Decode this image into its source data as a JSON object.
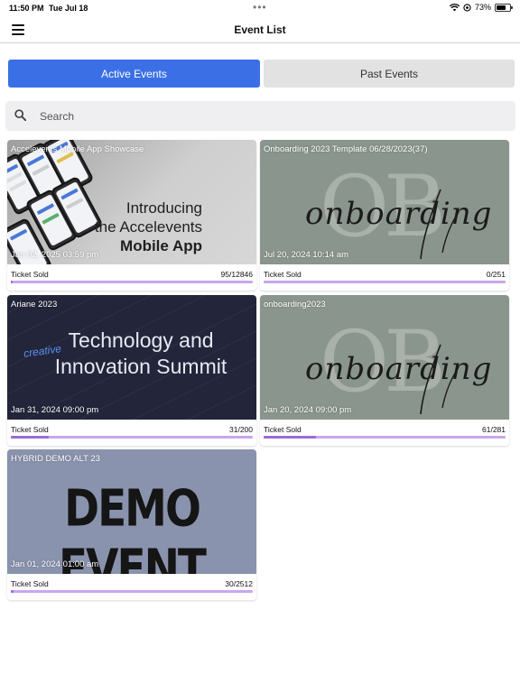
{
  "status_bar": {
    "time": "11:50 PM",
    "date": "Tue Jul 18",
    "battery": "73%",
    "battery_level": 0.73
  },
  "nav": {
    "title": "Event List",
    "menu_icon": "hamburger-icon"
  },
  "tabs": {
    "active_label": "Active Events",
    "past_label": "Past Events",
    "active_color": "#3b6fe6"
  },
  "search": {
    "placeholder": "Search",
    "icon": "search-icon"
  },
  "ticket_label": "Ticket Sold",
  "events": [
    {
      "title": "Accelevents Mobile App Showcase",
      "date": "Jan 02, 2025 03:59 pm",
      "sold": "95/12846",
      "sold_value": 95,
      "capacity": 12846,
      "art_line1": "Introducing",
      "art_line2": "the Accelevents",
      "art_line3": "Mobile App"
    },
    {
      "title": "Onboarding 2023 Template 06/28/2023(37)",
      "date": "Jul 20, 2024 10:14 am",
      "sold": "0/251",
      "sold_value": 0,
      "capacity": 251,
      "art_mono": "OB",
      "art_script": "onboarding"
    },
    {
      "title": "Ariane 2023",
      "date": "Jan 31, 2024 09:00 pm",
      "sold": "31/200",
      "sold_value": 31,
      "capacity": 200,
      "art_line1": "Technology and",
      "art_line2": "Innovation Summit",
      "art_accent": "creative"
    },
    {
      "title": "onboarding2023",
      "date": "Jan 20, 2024 09:00 pm",
      "sold": "61/281",
      "sold_value": 61,
      "capacity": 281,
      "art_mono": "OB",
      "art_script": "onboarding"
    },
    {
      "title": "HYBRID DEMO ALT 23",
      "date": "Jan 01, 2024 01:00 am",
      "sold": "30/2512",
      "sold_value": 30,
      "capacity": 2512,
      "art_text": "DEMO EVENT"
    }
  ]
}
